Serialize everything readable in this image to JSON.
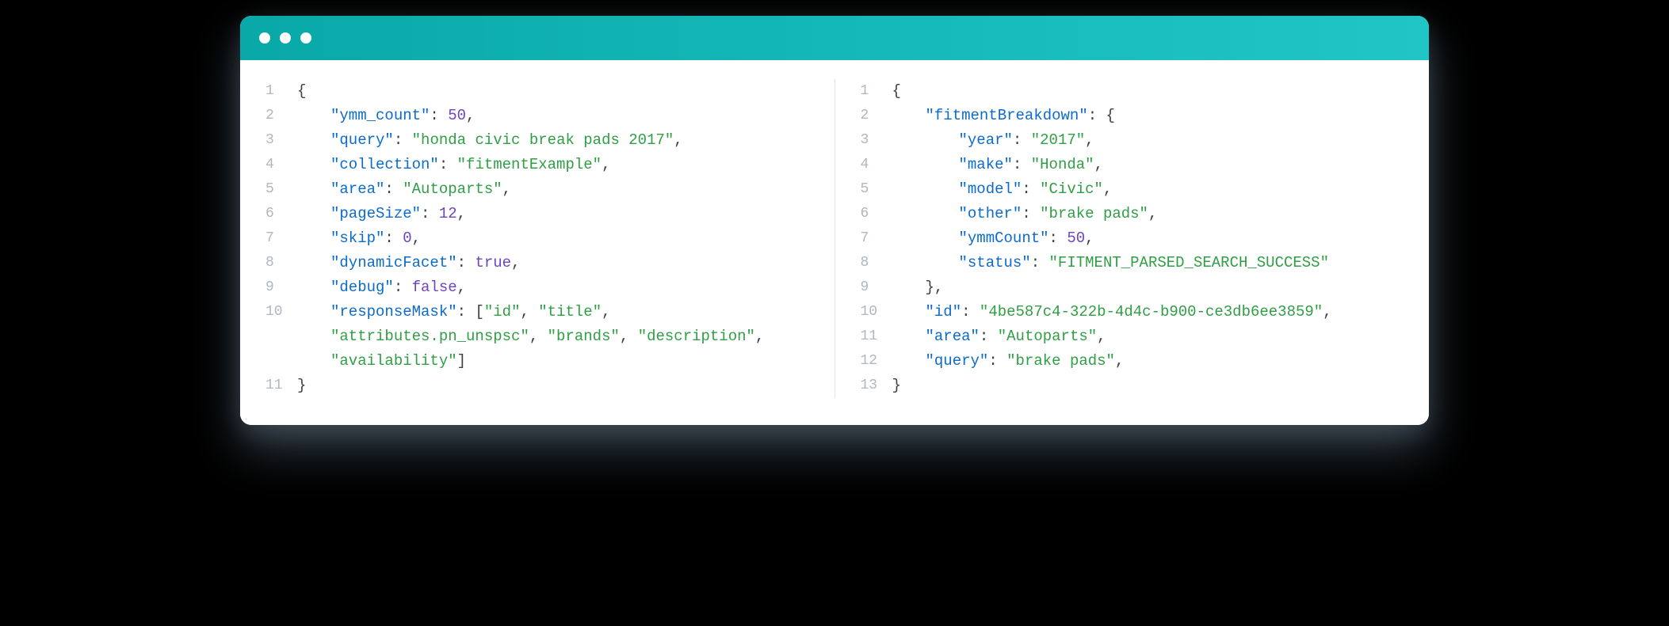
{
  "titlebar": {
    "dots": [
      "close",
      "minimize",
      "maximize"
    ]
  },
  "left": {
    "lines": [
      {
        "num": "1",
        "indent": 0,
        "tokens": [
          {
            "t": "p",
            "v": "{"
          }
        ]
      },
      {
        "num": "2",
        "indent": 1,
        "tokens": [
          {
            "t": "k",
            "v": "\"ymm_count\""
          },
          {
            "t": "p",
            "v": ": "
          },
          {
            "t": "n",
            "v": "50"
          },
          {
            "t": "p",
            "v": ","
          }
        ]
      },
      {
        "num": "3",
        "indent": 1,
        "tokens": [
          {
            "t": "k",
            "v": "\"query\""
          },
          {
            "t": "p",
            "v": ": "
          },
          {
            "t": "s",
            "v": "\"honda civic break pads 2017\""
          },
          {
            "t": "p",
            "v": ","
          }
        ]
      },
      {
        "num": "4",
        "indent": 1,
        "tokens": [
          {
            "t": "k",
            "v": "\"collection\""
          },
          {
            "t": "p",
            "v": ": "
          },
          {
            "t": "s",
            "v": "\"fitmentExample\""
          },
          {
            "t": "p",
            "v": ","
          }
        ]
      },
      {
        "num": "5",
        "indent": 1,
        "tokens": [
          {
            "t": "k",
            "v": "\"area\""
          },
          {
            "t": "p",
            "v": ": "
          },
          {
            "t": "s",
            "v": "\"Autoparts\""
          },
          {
            "t": "p",
            "v": ","
          }
        ]
      },
      {
        "num": "6",
        "indent": 1,
        "tokens": [
          {
            "t": "k",
            "v": "\"pageSize\""
          },
          {
            "t": "p",
            "v": ": "
          },
          {
            "t": "n",
            "v": "12"
          },
          {
            "t": "p",
            "v": ","
          }
        ]
      },
      {
        "num": "7",
        "indent": 1,
        "tokens": [
          {
            "t": "k",
            "v": "\"skip\""
          },
          {
            "t": "p",
            "v": ": "
          },
          {
            "t": "n",
            "v": "0"
          },
          {
            "t": "p",
            "v": ","
          }
        ]
      },
      {
        "num": "8",
        "indent": 1,
        "tokens": [
          {
            "t": "k",
            "v": "\"dynamicFacet\""
          },
          {
            "t": "p",
            "v": ": "
          },
          {
            "t": "b",
            "v": "true"
          },
          {
            "t": "p",
            "v": ","
          }
        ]
      },
      {
        "num": "9",
        "indent": 1,
        "tokens": [
          {
            "t": "k",
            "v": "\"debug\""
          },
          {
            "t": "p",
            "v": ": "
          },
          {
            "t": "b",
            "v": "false"
          },
          {
            "t": "p",
            "v": ","
          }
        ]
      },
      {
        "num": "10",
        "indent": 1,
        "tokens": [
          {
            "t": "k",
            "v": "\"responseMask\""
          },
          {
            "t": "p",
            "v": ": ["
          },
          {
            "t": "s",
            "v": "\"id\""
          },
          {
            "t": "p",
            "v": ", "
          },
          {
            "t": "s",
            "v": "\"title\""
          },
          {
            "t": "p",
            "v": ", "
          },
          {
            "t": "s",
            "v": "\"attributes.pn_unspsc\""
          },
          {
            "t": "p",
            "v": ", "
          },
          {
            "t": "s",
            "v": "\"brands\""
          },
          {
            "t": "p",
            "v": ", "
          },
          {
            "t": "s",
            "v": "\"description\""
          },
          {
            "t": "p",
            "v": ", "
          },
          {
            "t": "s",
            "v": "\"availability\""
          },
          {
            "t": "p",
            "v": "]"
          }
        ]
      },
      {
        "num": "11",
        "indent": 0,
        "tokens": [
          {
            "t": "p",
            "v": "}"
          }
        ]
      }
    ]
  },
  "right": {
    "lines": [
      {
        "num": "1",
        "indent": 0,
        "tokens": [
          {
            "t": "p",
            "v": "{"
          }
        ]
      },
      {
        "num": "2",
        "indent": 1,
        "tokens": [
          {
            "t": "k",
            "v": "\"fitmentBreakdown\""
          },
          {
            "t": "p",
            "v": ": {"
          }
        ]
      },
      {
        "num": "3",
        "indent": 2,
        "tokens": [
          {
            "t": "k",
            "v": "\"year\""
          },
          {
            "t": "p",
            "v": ": "
          },
          {
            "t": "s",
            "v": "\"2017\""
          },
          {
            "t": "p",
            "v": ","
          }
        ]
      },
      {
        "num": "4",
        "indent": 2,
        "tokens": [
          {
            "t": "k",
            "v": "\"make\""
          },
          {
            "t": "p",
            "v": ": "
          },
          {
            "t": "s",
            "v": "\"Honda\""
          },
          {
            "t": "p",
            "v": ","
          }
        ]
      },
      {
        "num": "5",
        "indent": 2,
        "tokens": [
          {
            "t": "k",
            "v": "\"model\""
          },
          {
            "t": "p",
            "v": ": "
          },
          {
            "t": "s",
            "v": "\"Civic\""
          },
          {
            "t": "p",
            "v": ","
          }
        ]
      },
      {
        "num": "6",
        "indent": 2,
        "tokens": [
          {
            "t": "k",
            "v": "\"other\""
          },
          {
            "t": "p",
            "v": ": "
          },
          {
            "t": "s",
            "v": "\"brake pads\""
          },
          {
            "t": "p",
            "v": ","
          }
        ]
      },
      {
        "num": "7",
        "indent": 2,
        "tokens": [
          {
            "t": "k",
            "v": "\"ymmCount\""
          },
          {
            "t": "p",
            "v": ": "
          },
          {
            "t": "n",
            "v": "50"
          },
          {
            "t": "p",
            "v": ","
          }
        ]
      },
      {
        "num": "8",
        "indent": 2,
        "tokens": [
          {
            "t": "k",
            "v": "\"status\""
          },
          {
            "t": "p",
            "v": ": "
          },
          {
            "t": "s",
            "v": "\"FITMENT_PARSED_SEARCH_SUCCESS\""
          }
        ]
      },
      {
        "num": "9",
        "indent": 1,
        "tokens": [
          {
            "t": "p",
            "v": "},"
          }
        ]
      },
      {
        "num": "10",
        "indent": 1,
        "tokens": [
          {
            "t": "k",
            "v": "\"id\""
          },
          {
            "t": "p",
            "v": ": "
          },
          {
            "t": "s",
            "v": "\"4be587c4-322b-4d4c-b900-ce3db6ee3859\""
          },
          {
            "t": "p",
            "v": ","
          }
        ]
      },
      {
        "num": "11",
        "indent": 1,
        "tokens": [
          {
            "t": "k",
            "v": "\"area\""
          },
          {
            "t": "p",
            "v": ": "
          },
          {
            "t": "s",
            "v": "\"Autoparts\""
          },
          {
            "t": "p",
            "v": ","
          }
        ]
      },
      {
        "num": "12",
        "indent": 1,
        "tokens": [
          {
            "t": "k",
            "v": "\"query\""
          },
          {
            "t": "p",
            "v": ": "
          },
          {
            "t": "s",
            "v": "\"brake pads\""
          },
          {
            "t": "p",
            "v": ","
          }
        ]
      },
      {
        "num": "13",
        "indent": 0,
        "tokens": [
          {
            "t": "p",
            "v": "}"
          }
        ]
      }
    ]
  }
}
